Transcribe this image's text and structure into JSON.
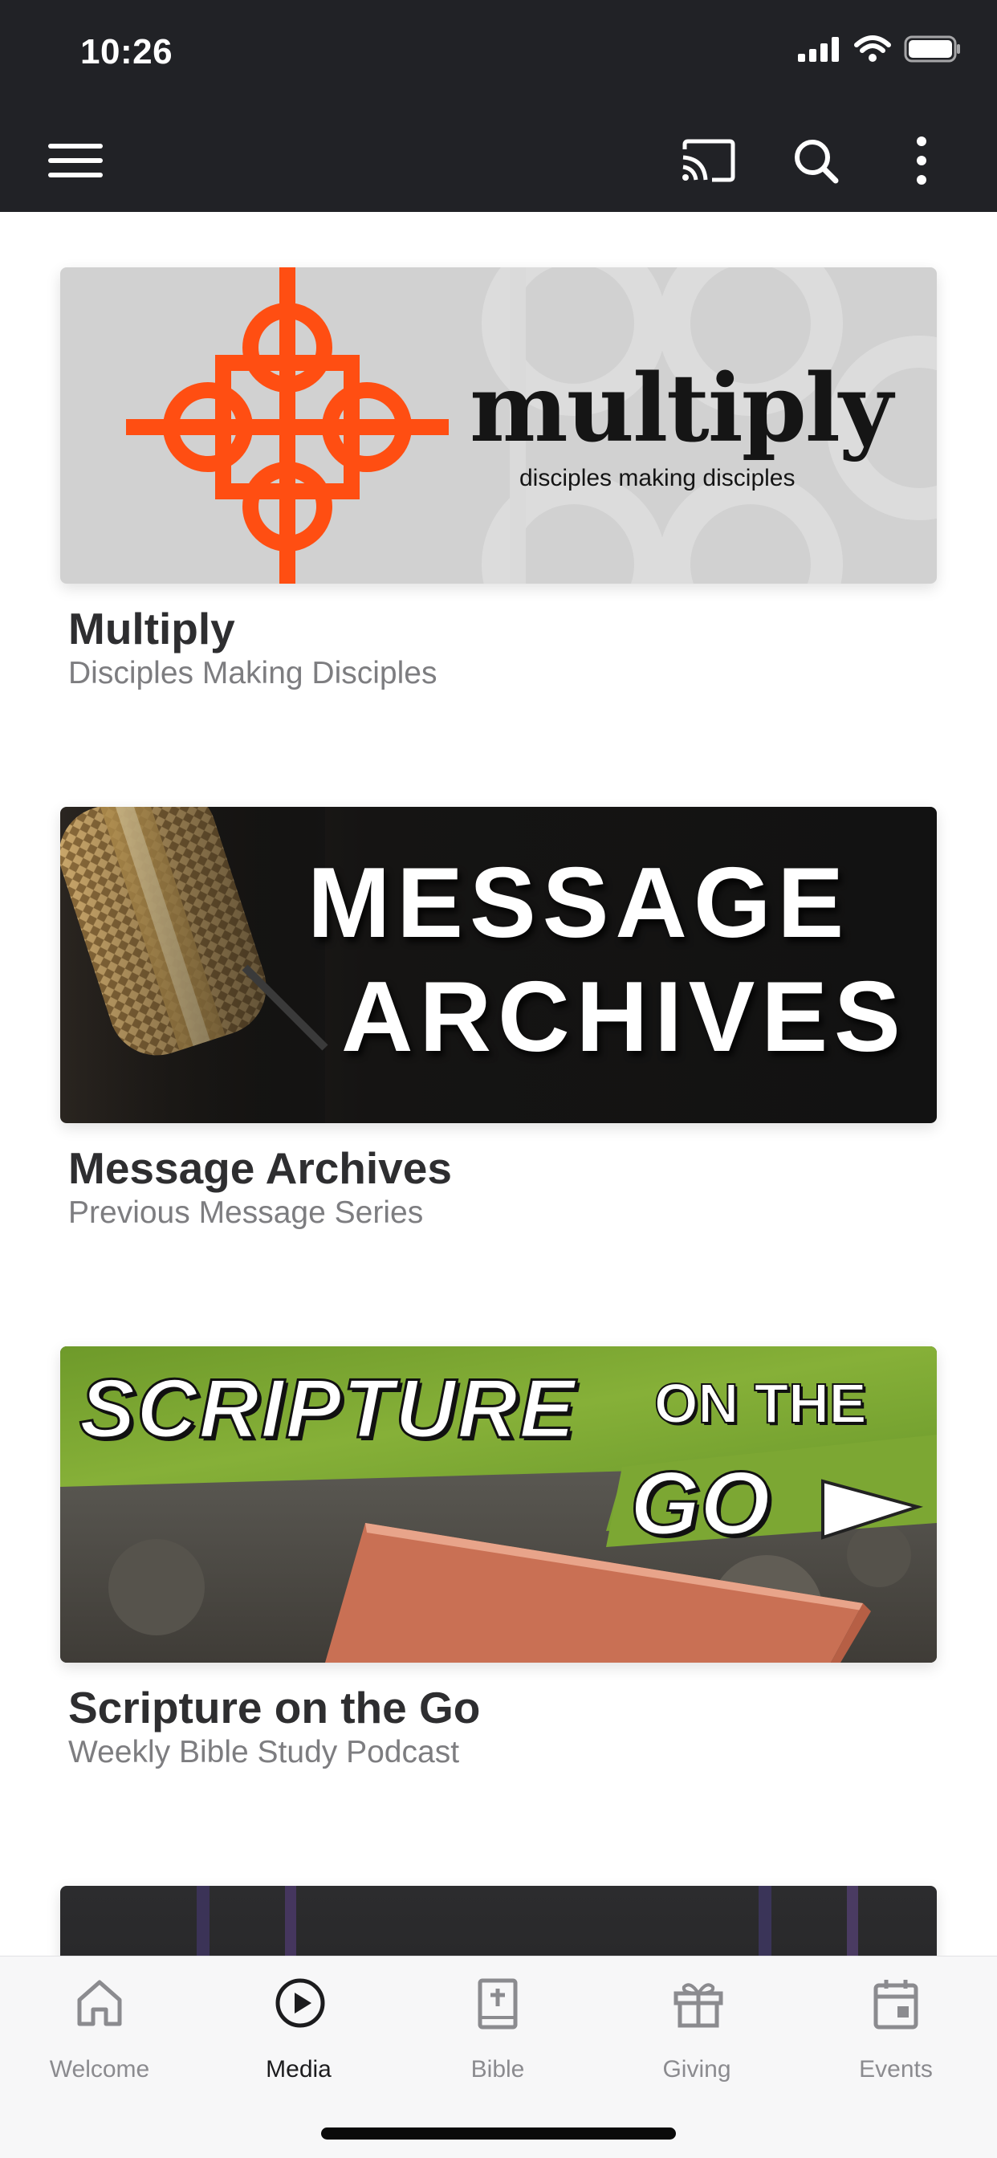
{
  "status_bar": {
    "time": "10:26"
  },
  "toolbar": {
    "menu_icon": "hamburger-menu-icon",
    "cast_icon": "cast-icon",
    "search_icon": "search-icon",
    "more_icon": "more-vertical-icon"
  },
  "cards": [
    {
      "title": "Multiply",
      "subtitle": "Disciples Making Disciples",
      "banner_word": "multiply",
      "banner_tagline": "disciples making disciples",
      "accent": "#ff4e12"
    },
    {
      "title": "Message Archives",
      "subtitle": "Previous Message Series",
      "banner_line1": "MESSAGE",
      "banner_line2": "ARCHIVES"
    },
    {
      "title": "Scripture on the Go",
      "subtitle": "Weekly Bible Study Podcast",
      "banner_line1": "SCRIPTURE",
      "banner_line2": "ON THE",
      "banner_line3": "GO",
      "accent": "#7ba231"
    }
  ],
  "tabs": [
    {
      "label": "Welcome",
      "icon": "home-icon",
      "active": false
    },
    {
      "label": "Media",
      "icon": "play-circle-icon",
      "active": true
    },
    {
      "label": "Bible",
      "icon": "bible-icon",
      "active": false
    },
    {
      "label": "Giving",
      "icon": "gift-icon",
      "active": false
    },
    {
      "label": "Events",
      "icon": "calendar-icon",
      "active": false
    }
  ]
}
